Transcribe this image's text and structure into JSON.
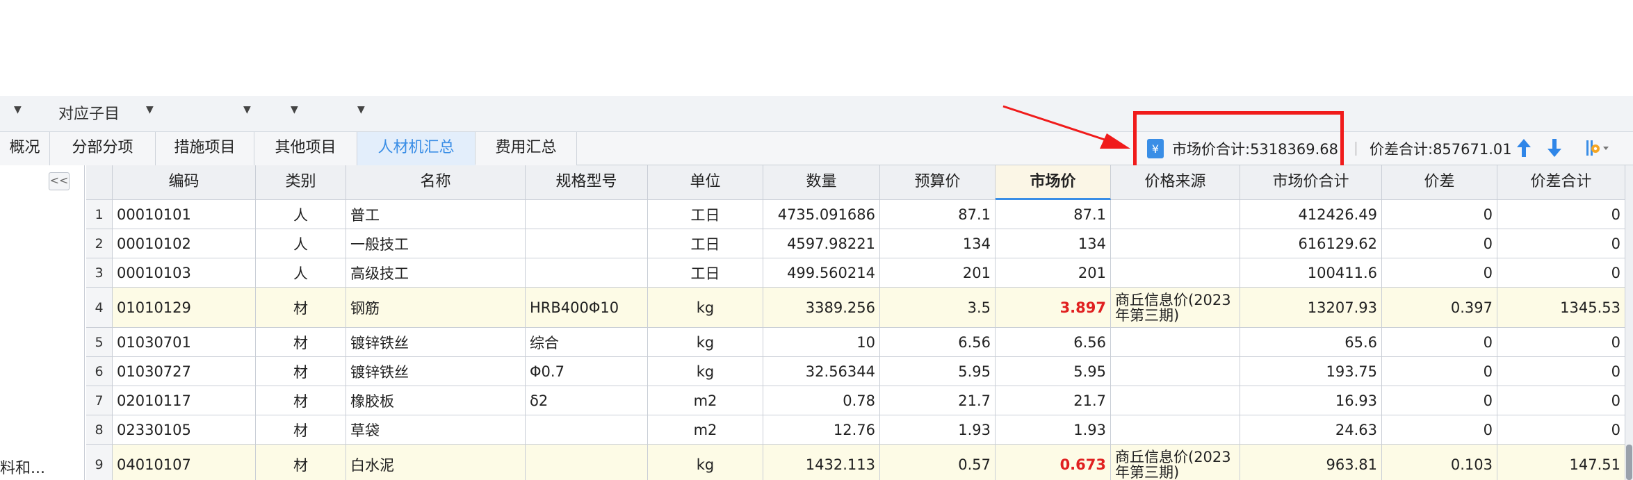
{
  "menu": {
    "row2": {
      "label": "对应子目"
    }
  },
  "tabs": [
    {
      "label": "概况"
    },
    {
      "label": "分部分项"
    },
    {
      "label": "措施项目"
    },
    {
      "label": "其他项目"
    },
    {
      "label": "人材机汇总"
    },
    {
      "label": "费用汇总"
    }
  ],
  "active_tab": "人材机汇总",
  "summary": {
    "market_total": "市场价合计:5318369.68",
    "diff_total": "价差合计:857671.01"
  },
  "left_panel": {
    "collapse": "<<",
    "item": "料和..."
  },
  "table": {
    "columns": [
      "编码",
      "类别",
      "名称",
      "规格型号",
      "单位",
      "数量",
      "预算价",
      "市场价",
      "价格来源",
      "市场价合计",
      "价差",
      "价差合计"
    ],
    "rows": [
      {
        "num": "1",
        "code": "00010101",
        "type": "人",
        "name": "普工",
        "spec": "",
        "unit": "工日",
        "qty": "4735.091686",
        "budget": "87.1",
        "market": "87.1",
        "source": "",
        "market_total": "412426.49",
        "diff": "0",
        "diff_total": "0"
      },
      {
        "num": "2",
        "code": "00010102",
        "type": "人",
        "name": "一般技工",
        "spec": "",
        "unit": "工日",
        "qty": "4597.98221",
        "budget": "134",
        "market": "134",
        "source": "",
        "market_total": "616129.62",
        "diff": "0",
        "diff_total": "0"
      },
      {
        "num": "3",
        "code": "00010103",
        "type": "人",
        "name": "高级技工",
        "spec": "",
        "unit": "工日",
        "qty": "499.560214",
        "budget": "201",
        "market": "201",
        "source": "",
        "market_total": "100411.6",
        "diff": "0",
        "diff_total": "0"
      },
      {
        "num": "4",
        "code": "01010129",
        "type": "材",
        "name": "钢筋",
        "spec": "HRB400Φ10",
        "unit": "kg",
        "qty": "3389.256",
        "budget": "3.5",
        "market": "3.897",
        "source": "商丘信息价(2023年第三期)",
        "market_total": "13207.93",
        "diff": "0.397",
        "diff_total": "1345.53"
      },
      {
        "num": "5",
        "code": "01030701",
        "type": "材",
        "name": "镀锌铁丝",
        "spec": "综合",
        "unit": "kg",
        "qty": "10",
        "budget": "6.56",
        "market": "6.56",
        "source": "",
        "market_total": "65.6",
        "diff": "0",
        "diff_total": "0"
      },
      {
        "num": "6",
        "code": "01030727",
        "type": "材",
        "name": "镀锌铁丝",
        "spec": "Φ0.7",
        "unit": "kg",
        "qty": "32.56344",
        "budget": "5.95",
        "market": "5.95",
        "source": "",
        "market_total": "193.75",
        "diff": "0",
        "diff_total": "0"
      },
      {
        "num": "7",
        "code": "02010117",
        "type": "材",
        "name": "橡胶板",
        "spec": "δ2",
        "unit": "m2",
        "qty": "0.78",
        "budget": "21.7",
        "market": "21.7",
        "source": "",
        "market_total": "16.93",
        "diff": "0",
        "diff_total": "0"
      },
      {
        "num": "8",
        "code": "02330105",
        "type": "材",
        "name": "草袋",
        "spec": "",
        "unit": "m2",
        "qty": "12.76",
        "budget": "1.93",
        "market": "1.93",
        "source": "",
        "market_total": "24.63",
        "diff": "0",
        "diff_total": "0"
      },
      {
        "num": "9",
        "code": "04010107",
        "type": "材",
        "name": "白水泥",
        "spec": "",
        "unit": "kg",
        "qty": "1432.113",
        "budget": "0.57",
        "market": "0.673",
        "source": "商丘信息价(2023年第三期)",
        "market_total": "963.81",
        "diff": "0.103",
        "diff_total": "147.51"
      }
    ]
  },
  "colors": {
    "accent": "#3a8ee6",
    "highlight_row": "#fdfbe6",
    "changed_price": "#e02020",
    "annotation": "#f01b1b"
  }
}
